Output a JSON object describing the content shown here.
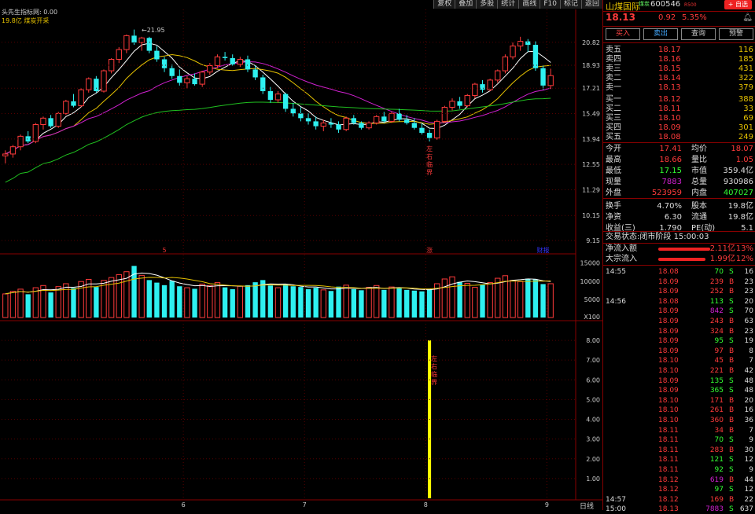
{
  "chart_header": {
    "title": "头先生指标网: 0.00",
    "subtitle": "19.8亿 煤炭开采"
  },
  "toolbar": [
    "复权",
    "叠加",
    "多股",
    "统计",
    "画线",
    "F10",
    "标记",
    "返回"
  ],
  "stock": {
    "name": "山煤国际",
    "tag": "煤炭",
    "code": "600546",
    "r_tag": "R500",
    "fav": "+ 自选",
    "price": "18.13",
    "change": "0.92",
    "pct": "5.35%"
  },
  "trade_buttons": {
    "buy": "买入",
    "sell": "卖出",
    "query": "查询",
    "preview": "预警"
  },
  "order_book": {
    "asks": [
      {
        "label": "卖五",
        "price": "18.17",
        "vol": "116"
      },
      {
        "label": "卖四",
        "price": "18.16",
        "vol": "185"
      },
      {
        "label": "卖三",
        "price": "18.15",
        "vol": "431"
      },
      {
        "label": "卖二",
        "price": "18.14",
        "vol": "322"
      },
      {
        "label": "卖一",
        "price": "18.13",
        "vol": "379"
      }
    ],
    "bids": [
      {
        "label": "买一",
        "price": "18.12",
        "vol": "388"
      },
      {
        "label": "买二",
        "price": "18.11",
        "vol": "33"
      },
      {
        "label": "买三",
        "price": "18.10",
        "vol": "69"
      },
      {
        "label": "买四",
        "price": "18.09",
        "vol": "301"
      },
      {
        "label": "买五",
        "price": "18.08",
        "vol": "249"
      }
    ]
  },
  "quote_stats": [
    [
      "今开",
      "17.41",
      "均价",
      "18.07"
    ],
    [
      "最高",
      "18.66",
      "量比",
      "1.05"
    ],
    [
      "最低",
      "17.15",
      "市值",
      "359.4亿"
    ],
    [
      "现量",
      "7883",
      "总量",
      "930986"
    ],
    [
      "外盘",
      "523959",
      "内盘",
      "407027"
    ],
    [
      "换手",
      "4.70%",
      "股本",
      "19.8亿"
    ],
    [
      "净资",
      "6.30",
      "流通",
      "19.8亿"
    ],
    [
      "收益(三)",
      "1.790",
      "PE(动)",
      "5.1"
    ]
  ],
  "trade_status": {
    "label": "交易状态:",
    "status": "闭市阶段",
    "time": "15:00:03"
  },
  "flows": [
    {
      "label": "净流入额",
      "value": "2.11亿",
      "pct": "13%"
    },
    {
      "label": "大宗流入",
      "value": "1.99亿",
      "pct": "12%"
    }
  ],
  "ticks": [
    {
      "time": "14:55",
      "price": "18.08",
      "vol": "70",
      "side": "S",
      "n": "16"
    },
    {
      "time": "",
      "price": "18.09",
      "vol": "239",
      "side": "B",
      "n": "23"
    },
    {
      "time": "",
      "price": "18.09",
      "vol": "252",
      "side": "B",
      "n": "23"
    },
    {
      "time": "14:56",
      "price": "18.08",
      "vol": "113",
      "side": "S",
      "n": "20"
    },
    {
      "time": "",
      "price": "18.09",
      "vol": "842",
      "side": "S",
      "n": "70"
    },
    {
      "time": "",
      "price": "18.09",
      "vol": "243",
      "side": "B",
      "n": "63"
    },
    {
      "time": "",
      "price": "18.09",
      "vol": "324",
      "side": "B",
      "n": "23"
    },
    {
      "time": "",
      "price": "18.09",
      "vol": "95",
      "side": "S",
      "n": "19"
    },
    {
      "time": "",
      "price": "18.09",
      "vol": "97",
      "side": "B",
      "n": "8"
    },
    {
      "time": "",
      "price": "18.10",
      "vol": "45",
      "side": "B",
      "n": "7"
    },
    {
      "time": "",
      "price": "18.10",
      "vol": "221",
      "side": "B",
      "n": "42"
    },
    {
      "time": "",
      "price": "18.09",
      "vol": "135",
      "side": "S",
      "n": "48"
    },
    {
      "time": "",
      "price": "18.09",
      "vol": "365",
      "side": "S",
      "n": "48"
    },
    {
      "time": "",
      "price": "18.10",
      "vol": "171",
      "side": "B",
      "n": "20"
    },
    {
      "time": "",
      "price": "18.10",
      "vol": "261",
      "side": "B",
      "n": "16"
    },
    {
      "time": "",
      "price": "18.10",
      "vol": "360",
      "side": "B",
      "n": "36"
    },
    {
      "time": "",
      "price": "18.11",
      "vol": "34",
      "side": "B",
      "n": "7"
    },
    {
      "time": "",
      "price": "18.11",
      "vol": "70",
      "side": "S",
      "n": "9"
    },
    {
      "time": "",
      "price": "18.11",
      "vol": "283",
      "side": "B",
      "n": "30"
    },
    {
      "time": "",
      "price": "18.11",
      "vol": "121",
      "side": "S",
      "n": "12"
    },
    {
      "time": "",
      "price": "18.11",
      "vol": "92",
      "side": "S",
      "n": "9"
    },
    {
      "time": "",
      "price": "18.12",
      "vol": "619",
      "side": "B",
      "n": "44"
    },
    {
      "time": "",
      "price": "18.12",
      "vol": "97",
      "side": "S",
      "n": "12"
    },
    {
      "time": "14:57",
      "price": "18.12",
      "vol": "169",
      "side": "B",
      "n": "22"
    },
    {
      "time": "15:00",
      "price": "18.13",
      "vol": "7883",
      "side": "S",
      "n": "637"
    }
  ],
  "price_axis": [
    "20.82",
    "18.93",
    "17.21",
    "15.49",
    "13.94",
    "12.55",
    "11.29",
    "10.15",
    "9.15"
  ],
  "volume_axis": [
    "15000",
    "10000",
    "5000",
    "X100"
  ],
  "indicator_axis": [
    "8.00",
    "7.00",
    "6.00",
    "5.00",
    "4.00",
    "3.00",
    "2.00",
    "1.00"
  ],
  "month_labels": [
    "6",
    "7",
    "8",
    "9"
  ],
  "event_markers": {
    "five": "5",
    "zhang": "涨",
    "caibao": "财报"
  },
  "peak_label": "21.95",
  "signal_label": "左右临界",
  "period_label": "日线",
  "colors": {
    "up": "#ff3b3b",
    "down": "#2ef0f0",
    "ma5": "#ffffff",
    "ma10": "#e6c200",
    "ma20": "#d020d0",
    "ma60": "#20c020",
    "signal": "#ffff00"
  },
  "chart_data": {
    "type": "candlestick",
    "y_axis_scale": "log",
    "ylim": [
      8.8,
      22.5
    ],
    "candles": [
      {
        "o": 13.0,
        "h": 13.3,
        "l": 12.6,
        "c": 13.1
      },
      {
        "o": 13.1,
        "h": 13.6,
        "l": 12.9,
        "c": 13.5
      },
      {
        "o": 13.5,
        "h": 14.2,
        "l": 13.3,
        "c": 14.1
      },
      {
        "o": 14.1,
        "h": 14.4,
        "l": 13.7,
        "c": 13.8
      },
      {
        "o": 13.8,
        "h": 14.9,
        "l": 13.7,
        "c": 14.8
      },
      {
        "o": 14.8,
        "h": 15.3,
        "l": 14.5,
        "c": 15.2
      },
      {
        "o": 15.2,
        "h": 15.4,
        "l": 14.6,
        "c": 14.7
      },
      {
        "o": 14.7,
        "h": 15.6,
        "l": 14.6,
        "c": 15.5
      },
      {
        "o": 15.5,
        "h": 16.4,
        "l": 15.4,
        "c": 16.3
      },
      {
        "o": 16.3,
        "h": 16.8,
        "l": 15.9,
        "c": 16.0
      },
      {
        "o": 16.0,
        "h": 17.2,
        "l": 15.9,
        "c": 17.1
      },
      {
        "o": 17.1,
        "h": 18.0,
        "l": 16.9,
        "c": 17.9
      },
      {
        "o": 17.9,
        "h": 18.1,
        "l": 16.9,
        "c": 17.0
      },
      {
        "o": 17.0,
        "h": 18.6,
        "l": 16.9,
        "c": 18.5
      },
      {
        "o": 18.5,
        "h": 19.5,
        "l": 18.3,
        "c": 19.4
      },
      {
        "o": 19.4,
        "h": 20.4,
        "l": 19.1,
        "c": 20.2
      },
      {
        "o": 20.2,
        "h": 21.5,
        "l": 19.9,
        "c": 21.4
      },
      {
        "o": 21.4,
        "h": 21.95,
        "l": 20.6,
        "c": 20.8
      },
      {
        "o": 20.8,
        "h": 21.3,
        "l": 20.1,
        "c": 21.2
      },
      {
        "o": 21.2,
        "h": 21.3,
        "l": 19.9,
        "c": 20.1
      },
      {
        "o": 20.1,
        "h": 20.5,
        "l": 19.2,
        "c": 19.4
      },
      {
        "o": 19.4,
        "h": 19.6,
        "l": 18.4,
        "c": 18.7
      },
      {
        "o": 18.7,
        "h": 19.0,
        "l": 17.9,
        "c": 18.1
      },
      {
        "o": 18.1,
        "h": 18.6,
        "l": 17.4,
        "c": 17.6
      },
      {
        "o": 17.6,
        "h": 18.1,
        "l": 17.2,
        "c": 17.9
      },
      {
        "o": 17.9,
        "h": 18.3,
        "l": 17.4,
        "c": 17.5
      },
      {
        "o": 17.5,
        "h": 18.5,
        "l": 17.3,
        "c": 18.4
      },
      {
        "o": 18.4,
        "h": 19.1,
        "l": 18.2,
        "c": 18.9
      },
      {
        "o": 18.9,
        "h": 19.8,
        "l": 18.7,
        "c": 19.6
      },
      {
        "o": 19.6,
        "h": 20.0,
        "l": 19.3,
        "c": 19.5
      },
      {
        "o": 19.5,
        "h": 19.8,
        "l": 18.9,
        "c": 19.0
      },
      {
        "o": 19.0,
        "h": 19.6,
        "l": 18.8,
        "c": 19.4
      },
      {
        "o": 19.4,
        "h": 19.7,
        "l": 18.4,
        "c": 18.6
      },
      {
        "o": 18.6,
        "h": 18.9,
        "l": 17.8,
        "c": 18.0
      },
      {
        "o": 18.0,
        "h": 18.2,
        "l": 16.8,
        "c": 17.0
      },
      {
        "o": 17.0,
        "h": 17.3,
        "l": 16.2,
        "c": 16.4
      },
      {
        "o": 16.4,
        "h": 17.0,
        "l": 16.2,
        "c": 16.8
      },
      {
        "o": 16.8,
        "h": 16.9,
        "l": 15.6,
        "c": 15.8
      },
      {
        "o": 15.8,
        "h": 16.2,
        "l": 15.3,
        "c": 15.5
      },
      {
        "o": 15.5,
        "h": 15.9,
        "l": 15.0,
        "c": 15.2
      },
      {
        "o": 15.2,
        "h": 15.5,
        "l": 14.8,
        "c": 15.0
      },
      {
        "o": 15.0,
        "h": 15.3,
        "l": 14.5,
        "c": 14.7
      },
      {
        "o": 14.7,
        "h": 15.1,
        "l": 14.4,
        "c": 14.9
      },
      {
        "o": 14.9,
        "h": 15.2,
        "l": 14.6,
        "c": 14.8
      },
      {
        "o": 14.8,
        "h": 15.0,
        "l": 14.3,
        "c": 14.5
      },
      {
        "o": 14.5,
        "h": 15.3,
        "l": 14.4,
        "c": 15.2
      },
      {
        "o": 15.2,
        "h": 15.4,
        "l": 14.8,
        "c": 14.9
      },
      {
        "o": 14.9,
        "h": 15.0,
        "l": 14.5,
        "c": 14.6
      },
      {
        "o": 14.6,
        "h": 15.0,
        "l": 14.5,
        "c": 14.9
      },
      {
        "o": 14.9,
        "h": 15.4,
        "l": 14.8,
        "c": 15.3
      },
      {
        "o": 15.3,
        "h": 15.6,
        "l": 14.9,
        "c": 15.0
      },
      {
        "o": 15.0,
        "h": 15.6,
        "l": 14.9,
        "c": 15.5
      },
      {
        "o": 15.5,
        "h": 15.8,
        "l": 15.0,
        "c": 15.1
      },
      {
        "o": 15.1,
        "h": 15.4,
        "l": 14.8,
        "c": 14.9
      },
      {
        "o": 14.9,
        "h": 15.2,
        "l": 14.5,
        "c": 14.6
      },
      {
        "o": 14.6,
        "h": 14.9,
        "l": 14.2,
        "c": 14.3
      },
      {
        "o": 14.3,
        "h": 14.5,
        "l": 13.8,
        "c": 14.0
      },
      {
        "o": 14.0,
        "h": 15.1,
        "l": 13.9,
        "c": 15.0
      },
      {
        "o": 15.0,
        "h": 16.0,
        "l": 14.9,
        "c": 15.9
      },
      {
        "o": 15.9,
        "h": 16.5,
        "l": 15.7,
        "c": 16.3
      },
      {
        "o": 16.3,
        "h": 16.6,
        "l": 15.8,
        "c": 16.0
      },
      {
        "o": 16.0,
        "h": 16.8,
        "l": 15.9,
        "c": 16.7
      },
      {
        "o": 16.7,
        "h": 17.6,
        "l": 16.5,
        "c": 17.5
      },
      {
        "o": 17.5,
        "h": 17.8,
        "l": 16.9,
        "c": 17.1
      },
      {
        "o": 17.1,
        "h": 17.9,
        "l": 17.0,
        "c": 17.8
      },
      {
        "o": 17.8,
        "h": 18.6,
        "l": 17.6,
        "c": 18.5
      },
      {
        "o": 18.5,
        "h": 19.8,
        "l": 18.3,
        "c": 19.6
      },
      {
        "o": 19.6,
        "h": 20.8,
        "l": 19.4,
        "c": 20.5
      },
      {
        "o": 20.5,
        "h": 21.3,
        "l": 20.1,
        "c": 20.9
      },
      {
        "o": 20.9,
        "h": 21.1,
        "l": 20.0,
        "c": 20.6
      },
      {
        "o": 20.6,
        "h": 20.9,
        "l": 18.5,
        "c": 18.7
      },
      {
        "o": 18.7,
        "h": 18.9,
        "l": 17.1,
        "c": 17.4
      },
      {
        "o": 17.4,
        "h": 18.66,
        "l": 17.15,
        "c": 18.13
      }
    ],
    "volume": [
      6500,
      7200,
      7800,
      6400,
      8200,
      8800,
      6900,
      8500,
      9300,
      8100,
      9900,
      10500,
      8400,
      10200,
      11000,
      11800,
      12600,
      14200,
      11600,
      10300,
      9600,
      8900,
      10100,
      8600,
      8200,
      7900,
      9200,
      8800,
      9600,
      8300,
      7800,
      8600,
      8900,
      9700,
      10300,
      8800,
      8200,
      9100,
      8600,
      8400,
      7800,
      8200,
      7600,
      7300,
      8500,
      8900,
      7800,
      7500,
      8300,
      8800,
      7600,
      8400,
      8100,
      7600,
      7400,
      7200,
      7800,
      9300,
      10600,
      11200,
      9800,
      9400,
      8300,
      9100,
      9600,
      10800,
      11500,
      10200,
      9900,
      10700,
      10500,
      9200,
      9300
    ],
    "signal_index": 56,
    "signal_value": 8.0,
    "month_boundaries": [
      {
        "label": "6",
        "index": 24
      },
      {
        "label": "7",
        "index": 40
      },
      {
        "label": "8",
        "index": 56
      },
      {
        "label": "9",
        "index": 72
      }
    ],
    "markers": [
      {
        "label": "5",
        "index": 21
      },
      {
        "label": "涨",
        "index": 56
      },
      {
        "label": "财报",
        "index": 71
      }
    ]
  }
}
